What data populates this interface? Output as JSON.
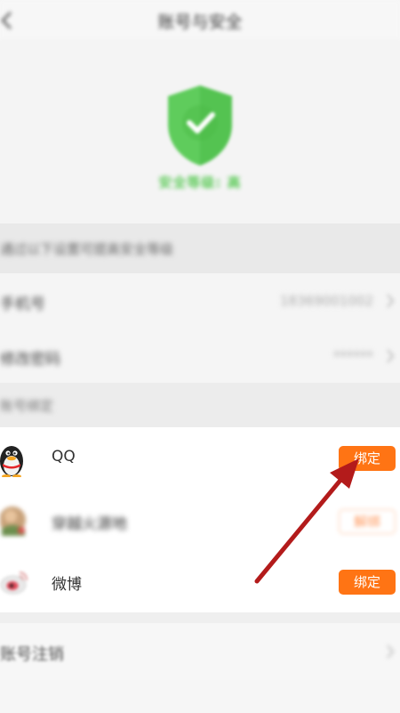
{
  "header": {
    "title": "账号与安全"
  },
  "security": {
    "level_text": "安全等级: 高"
  },
  "hint": {
    "text": "通过以下设置可提高安全等级"
  },
  "settings": {
    "phone": {
      "label": "手机号",
      "value": "18369001002"
    },
    "password": {
      "label": "修改密码",
      "value": "******"
    }
  },
  "binding": {
    "section_label": "账号绑定",
    "items": [
      {
        "name": "QQ",
        "icon": "qq-penguin-icon",
        "button": "绑定"
      },
      {
        "name": "穿越火源地",
        "icon": "game-avatar-icon",
        "button": "解绑"
      },
      {
        "name": "微博",
        "icon": "weibo-icon",
        "button": "绑定"
      }
    ]
  },
  "account": {
    "cancel_label": "账号注销"
  },
  "colors": {
    "accent": "#ff7414",
    "shield_green": "#5ecb5a",
    "arrow_red": "#b31b1b"
  }
}
